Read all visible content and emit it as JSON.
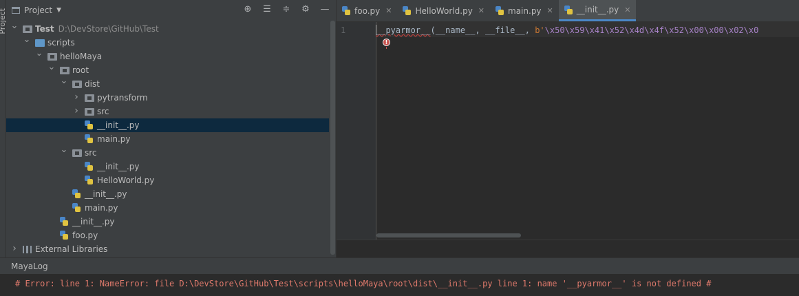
{
  "sidebar_strip": {
    "label": "Project"
  },
  "project_panel": {
    "title": "Project",
    "tools": [
      "target-icon",
      "expand-icon",
      "collapse-icon",
      "gear-icon",
      "minimize-icon"
    ],
    "tree": [
      {
        "label": "Test",
        "path": "D:\\DevStore\\GitHub\\Test",
        "bold": true,
        "depth": 0,
        "arrow": "down",
        "icon": "folder"
      },
      {
        "label": "scripts",
        "depth": 1,
        "arrow": "down",
        "icon": "folder-blue"
      },
      {
        "label": "helloMaya",
        "depth": 2,
        "arrow": "down",
        "icon": "folder"
      },
      {
        "label": "root",
        "depth": 3,
        "arrow": "down",
        "icon": "folder"
      },
      {
        "label": "dist",
        "depth": 4,
        "arrow": "down",
        "icon": "folder"
      },
      {
        "label": "pytransform",
        "depth": 5,
        "arrow": "right",
        "icon": "folder"
      },
      {
        "label": "src",
        "depth": 5,
        "arrow": "right",
        "icon": "folder"
      },
      {
        "label": "__init__.py",
        "depth": 5,
        "icon": "python",
        "selected": true
      },
      {
        "label": "main.py",
        "depth": 5,
        "icon": "python"
      },
      {
        "label": "src",
        "depth": 4,
        "arrow": "down",
        "icon": "folder"
      },
      {
        "label": "__init__.py",
        "depth": 5,
        "icon": "python"
      },
      {
        "label": "HelloWorld.py",
        "depth": 5,
        "icon": "python"
      },
      {
        "label": "__init__.py",
        "depth": 4,
        "icon": "python"
      },
      {
        "label": "main.py",
        "depth": 4,
        "icon": "python"
      },
      {
        "label": "__init__.py",
        "depth": 3,
        "icon": "python"
      },
      {
        "label": "foo.py",
        "depth": 3,
        "icon": "python"
      },
      {
        "label": "External Libraries",
        "depth": 0,
        "arrow": "right",
        "icon": "libraries"
      }
    ]
  },
  "editor": {
    "tabs": [
      {
        "label": "foo.py",
        "active": false
      },
      {
        "label": "HelloWorld.py",
        "active": false
      },
      {
        "label": "main.py",
        "active": false
      },
      {
        "label": "__init__.py",
        "active": true
      }
    ],
    "line_number": "1",
    "code": {
      "fn": "__pyarmor__",
      "args": "(__name__, __file__, ",
      "prefix": "b'",
      "bytes": "\\x50\\x59\\x41\\x52\\x4d\\x4f\\x52\\x00\\x00\\x02\\x0"
    }
  },
  "log": {
    "title": "MayaLog",
    "message": "# Error: line 1: NameError: file D:\\DevStore\\GitHub\\Test\\scripts\\helloMaya\\root\\dist\\__init__.py line 1: name '__pyarmor__' is not defined #"
  },
  "colors": {
    "panel_bg": "#3c3f41",
    "editor_bg": "#2b2b2b",
    "selection": "#0d293e",
    "accent": "#4a88c7",
    "error_text": "#e07a6c",
    "string_bytes": "#a782c7"
  }
}
